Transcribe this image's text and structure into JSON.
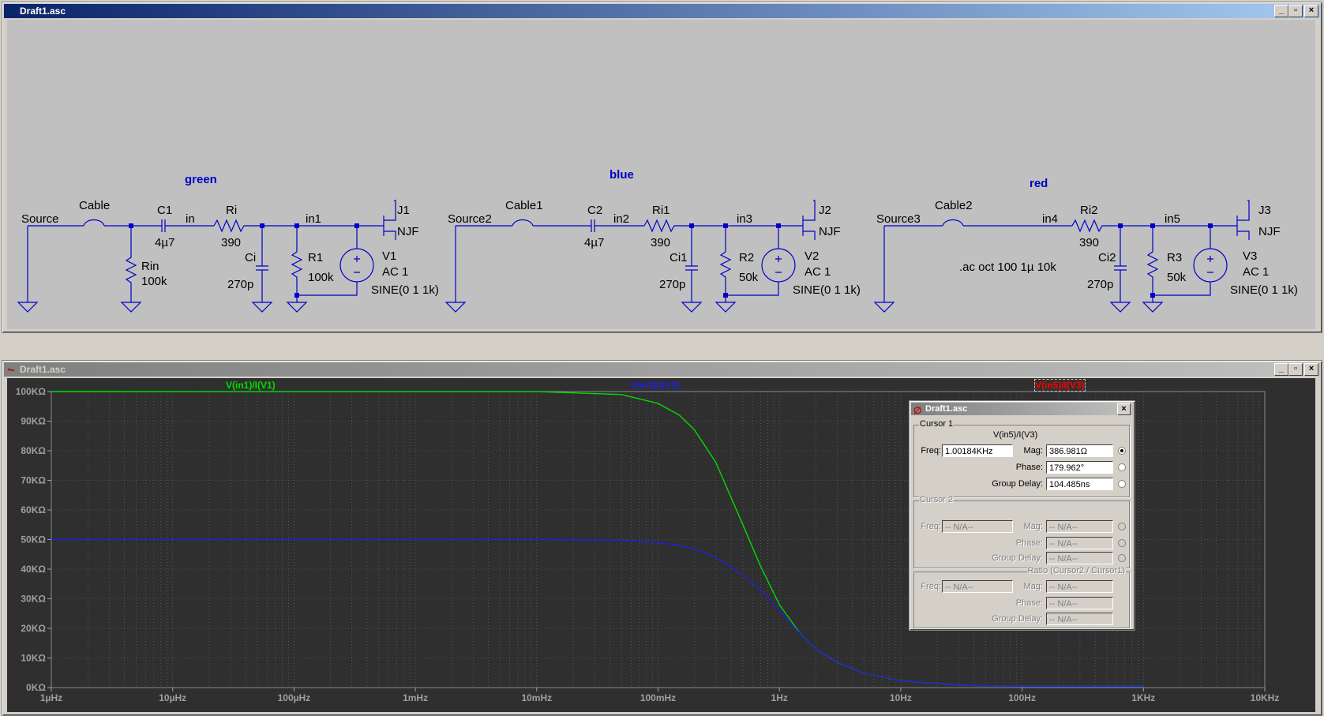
{
  "schematic_window": {
    "title": "Draft1.asc",
    "net_labels": [
      "green",
      "blue",
      "red"
    ],
    "circuits": [
      {
        "source": "Source",
        "cable": "Cable",
        "cap": "C1",
        "cap_val": "4µ7",
        "node_a": "in",
        "rin": "Rin",
        "rin_val": "100k",
        "ri": "Ri",
        "ri_val": "390",
        "ci": "Ci",
        "ci_val": "270p",
        "node_b": "in1",
        "r": "R1",
        "r_val": "100k",
        "v": "V1",
        "v_ac": "AC 1",
        "v_sine": "SINE(0 1 1k)",
        "j": "J1",
        "j_type": "NJF"
      },
      {
        "source": "Source2",
        "cable": "Cable1",
        "cap": "C2",
        "cap_val": "4µ7",
        "node_a": "in2",
        "ri": "Ri1",
        "ri_val": "390",
        "ci": "Ci1",
        "ci_val": "270p",
        "node_b": "in3",
        "r": "R2",
        "r_val": "50k",
        "v": "V2",
        "v_ac": "AC 1",
        "v_sine": "SINE(0 1 1k)",
        "j": "J2",
        "j_type": "NJF"
      },
      {
        "source": "Source3",
        "cable": "Cable2",
        "node_a": "in4",
        "ri": "Ri2",
        "ri_val": "390",
        "ci": "Ci2",
        "ci_val": "270p",
        "node_b": "in5",
        "r": "R3",
        "r_val": "50k",
        "v": "V3",
        "v_ac": "AC 1",
        "v_sine": "SINE(0 1 1k)",
        "j": "J3",
        "j_type": "NJF"
      }
    ],
    "directive": ".ac oct 100 1µ 10k"
  },
  "plot_window": {
    "title": "Draft1.asc",
    "trace_labels": [
      "V(in1)/I(V1)",
      "V(in3)/I(V2)",
      "V(in5)/I(V3)"
    ]
  },
  "cursor_window": {
    "title": "Draft1.asc",
    "cursor1": {
      "group_label": "Cursor 1",
      "trace": "V(in5)/I(V3)",
      "freq_label": "Freq:",
      "freq": "1.00184KHz",
      "mag_label": "Mag:",
      "mag": "386.981Ω",
      "phase_label": "Phase:",
      "phase": "179.962°",
      "gd_label": "Group Delay:",
      "gd": "104.485ns"
    },
    "cursor2": {
      "group_label": "Cursor 2",
      "freq_label": "Freq:",
      "freq": "-- N/A--",
      "mag_label": "Mag:",
      "mag": "-- N/A--",
      "phase_label": "Phase:",
      "phase": "-- N/A--",
      "gd_label": "Group Delay:",
      "gd": "-- N/A--"
    },
    "ratio": {
      "group_label": "Ratio (Cursor2 / Cursor1)",
      "freq_label": "Freq:",
      "freq": "-- N/A--",
      "mag_label": "Mag:",
      "mag": "-- N/A--",
      "phase_label": "Phase:",
      "phase": "-- N/A--",
      "gd_label": "Group Delay:",
      "gd": "-- N/A--"
    }
  },
  "colors": {
    "schematic_wire": "#0000c8",
    "plot_bg": "#2f2f2f",
    "trace1": "#00dd00",
    "trace2": "#2020dd",
    "trace3": "#ff0000",
    "title_active": "#0a246a"
  },
  "chart_data": {
    "type": "line",
    "x_scale": "log",
    "xlim": [
      1e-06,
      10000
    ],
    "ylim": [
      0,
      100000
    ],
    "x_tick_labels": [
      "1µHz",
      "10µHz",
      "100µHz",
      "1mHz",
      "10mHz",
      "100mHz",
      "1Hz",
      "10Hz",
      "100Hz",
      "1KHz",
      "10KHz"
    ],
    "y_tick_labels": [
      "0KΩ",
      "10KΩ",
      "20KΩ",
      "30KΩ",
      "40KΩ",
      "50KΩ",
      "60KΩ",
      "70KΩ",
      "80KΩ",
      "90KΩ",
      "100KΩ"
    ],
    "grid": true,
    "series": [
      {
        "name": "V(in1)/I(V1)",
        "x": [
          1e-06,
          0.01,
          0.05,
          0.1,
          0.15,
          0.2,
          0.3,
          0.5,
          0.7,
          1,
          1.5,
          2,
          3,
          5,
          10,
          30,
          100,
          1000
        ],
        "y": [
          100000,
          99980,
          99000,
          96000,
          92000,
          87000,
          76000,
          55000,
          41000,
          28000,
          18000,
          13000,
          8500,
          4800,
          2300,
          800,
          400,
          390
        ]
      },
      {
        "name": "V(in3)/I(V2)",
        "x": [
          1e-06,
          0.01,
          0.05,
          0.1,
          0.15,
          0.2,
          0.3,
          0.5,
          0.7,
          1,
          1.5,
          2,
          3,
          5,
          10,
          30,
          100,
          1000
        ],
        "y": [
          50000,
          49990,
          49800,
          49000,
          48000,
          46800,
          44000,
          38000,
          33000,
          26000,
          18000,
          13000,
          8500,
          4800,
          2300,
          800,
          400,
          390
        ]
      }
    ]
  }
}
